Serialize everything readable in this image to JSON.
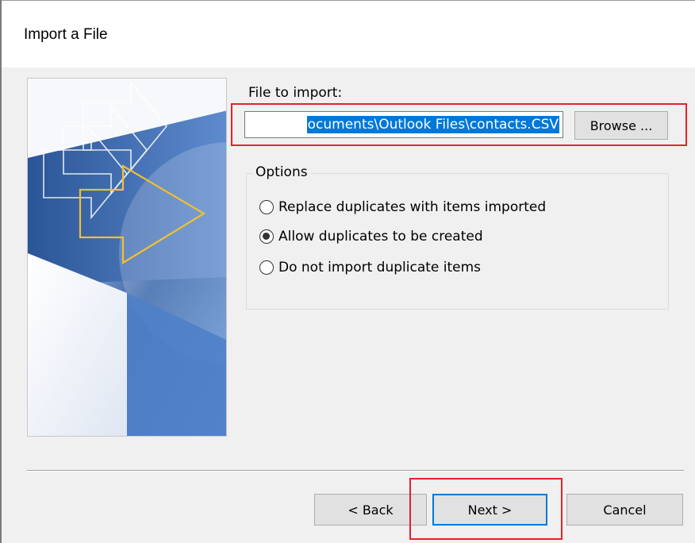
{
  "window": {
    "title": "Import a File"
  },
  "file_section": {
    "label": "File to import:",
    "value": "ocuments\\Outlook Files\\contacts.CSV",
    "browse_label": "Browse ..."
  },
  "options": {
    "legend": "Options",
    "items": [
      {
        "label": "Replace duplicates with items imported",
        "checked": false
      },
      {
        "label": "Allow duplicates to be created",
        "checked": true
      },
      {
        "label": "Do not import duplicate items",
        "checked": false
      }
    ]
  },
  "footer": {
    "back_label": "< Back",
    "next_label": "Next >",
    "cancel_label": "Cancel"
  },
  "colors": {
    "highlight": "#e8202a",
    "accent": "#0078d7",
    "arrow_yellow": "#f0c030"
  }
}
